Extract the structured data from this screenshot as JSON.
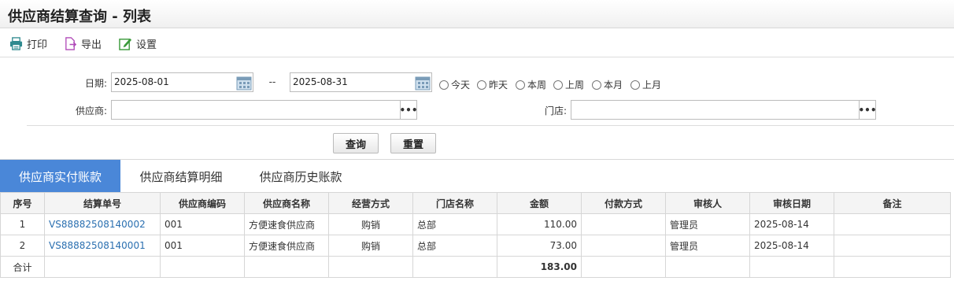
{
  "page": {
    "title": "供应商结算查询 - 列表"
  },
  "toolbar": {
    "print": "打印",
    "export": "导出",
    "settings": "设置"
  },
  "filter": {
    "date_label": "日期:",
    "date_from": "2025-08-01",
    "date_sep": "--",
    "date_to": "2025-08-31",
    "quick_ranges": [
      "今天",
      "昨天",
      "本周",
      "上周",
      "本月",
      "上月"
    ],
    "supplier_label": "供应商:",
    "supplier_value": "",
    "store_label": "门店:",
    "store_value": "",
    "dots": "•••",
    "query_button": "查询",
    "reset_button": "重置"
  },
  "tabs": [
    {
      "label": "供应商实付账款",
      "active": true
    },
    {
      "label": "供应商结算明细",
      "active": false
    },
    {
      "label": "供应商历史账款",
      "active": false
    }
  ],
  "table": {
    "columns": [
      "序号",
      "结算单号",
      "供应商编码",
      "供应商名称",
      "经营方式",
      "门店名称",
      "金额",
      "付款方式",
      "审核人",
      "审核日期",
      "备注"
    ],
    "rows": [
      [
        "1",
        "VS88882508140002",
        "001",
        "方便速食供应商",
        "购销",
        "总部",
        "110.00",
        "",
        "管理员",
        "2025-08-14",
        ""
      ],
      [
        "2",
        "VS88882508140001",
        "001",
        "方便速食供应商",
        "购销",
        "总部",
        "73.00",
        "",
        "管理员",
        "2025-08-14",
        ""
      ]
    ],
    "total_label": "合计",
    "total_amount": "183.00"
  }
}
